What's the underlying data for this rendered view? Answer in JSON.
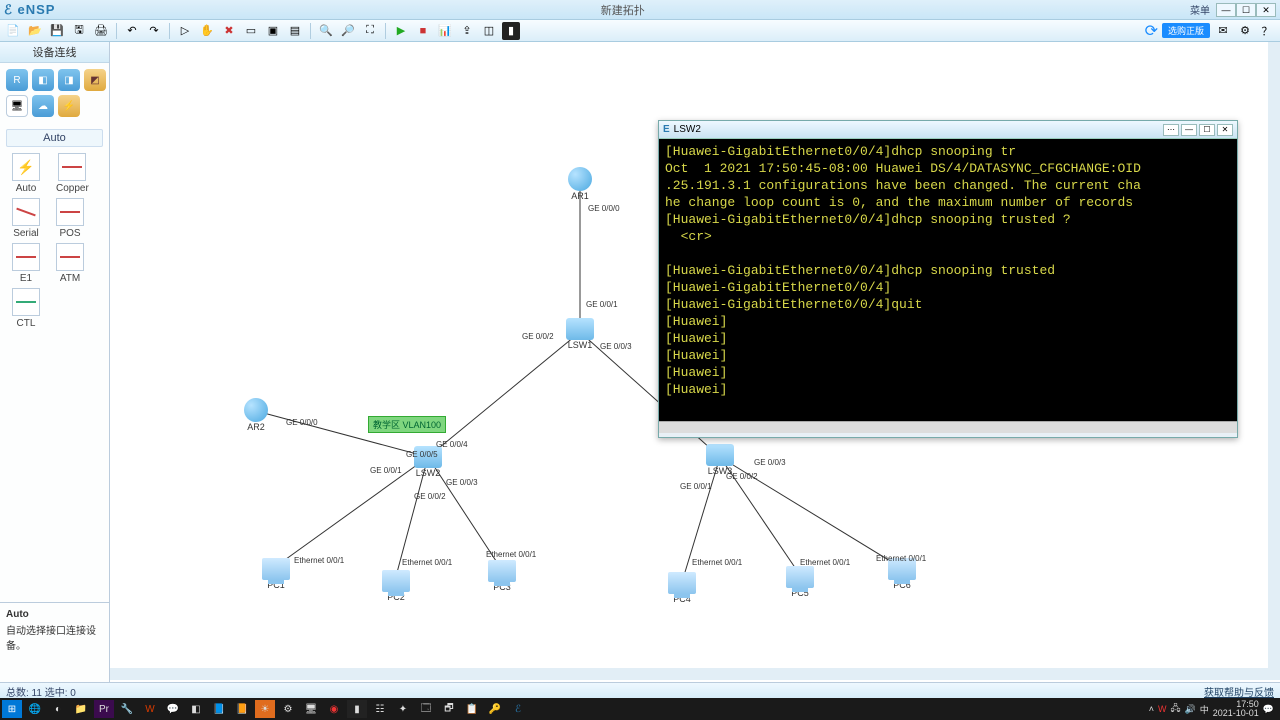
{
  "app": {
    "name": "eNSP",
    "doc_title": "新建拓扑",
    "menu_label": "菜单",
    "badge": "选购正版"
  },
  "sidebar": {
    "title": "设备连线",
    "auto_label": "Auto",
    "conn": {
      "auto": "Auto",
      "copper": "Copper",
      "serial": "Serial",
      "pos": "POS",
      "e1": "E1",
      "atm": "ATM",
      "ctl": "CTL"
    },
    "desc_title": "Auto",
    "desc_text": "自动选择接口连接设备。"
  },
  "status": {
    "left": "总数: 11  选中: 0",
    "right": "获取帮助与反馈"
  },
  "topology": {
    "vlan_tag": "教学区  VLAN100",
    "nodes": {
      "ar1": "AR1",
      "ar2": "AR2",
      "lsw1": "LSW1",
      "lsw2": "LSW2",
      "lsw3": "LSW3",
      "pc1": "PC1",
      "pc2": "PC2",
      "pc3": "PC3",
      "pc4": "PC4",
      "pc5": "PC5",
      "pc6": "PC6"
    },
    "if": {
      "ar1_g000": "GE 0/0/0",
      "lsw1_g001": "GE 0/0/1",
      "lsw1_g002": "GE 0/0/2",
      "lsw1_g003": "GE 0/0/3",
      "ar2_g000": "GE 0/0/0",
      "lsw2_g001": "GE 0/0/1",
      "lsw2_g002": "GE 0/0/2",
      "lsw2_g003": "GE 0/0/3",
      "lsw2_g004": "GE 0/0/4",
      "lsw2_g005": "GE 0/0/5",
      "lsw3_g001": "GE 0/0/1",
      "lsw3_g002": "GE 0/0/2",
      "lsw3_g003": "GE 0/0/3",
      "pc1_e001": "Ethernet 0/0/1",
      "pc2_e001": "Ethernet 0/0/1",
      "pc3_e001": "Ethernet 0/0/1",
      "pc4_e001": "Ethernet 0/0/1",
      "pc5_e001": "Ethernet 0/0/1",
      "pc6_e001": "Ethernet 0/0/1"
    }
  },
  "terminal": {
    "title_prefix": "E",
    "title": "LSW2",
    "lines": [
      "[Huawei-GigabitEthernet0/0/4]dhcp snooping tr",
      "Oct  1 2021 17:50:45-08:00 Huawei DS/4/DATASYNC_CFGCHANGE:OID",
      ".25.191.3.1 configurations have been changed. The current cha",
      "he change loop count is 0, and the maximum number of records ",
      "[Huawei-GigabitEthernet0/0/4]dhcp snooping trusted ?",
      "  <cr>",
      "",
      "[Huawei-GigabitEthernet0/0/4]dhcp snooping trusted",
      "[Huawei-GigabitEthernet0/0/4]",
      "[Huawei-GigabitEthernet0/0/4]quit",
      "[Huawei]",
      "[Huawei]",
      "[Huawei]",
      "[Huawei]",
      "[Huawei]"
    ]
  },
  "clock": {
    "time": "17:50",
    "date": "2021-10-01"
  }
}
